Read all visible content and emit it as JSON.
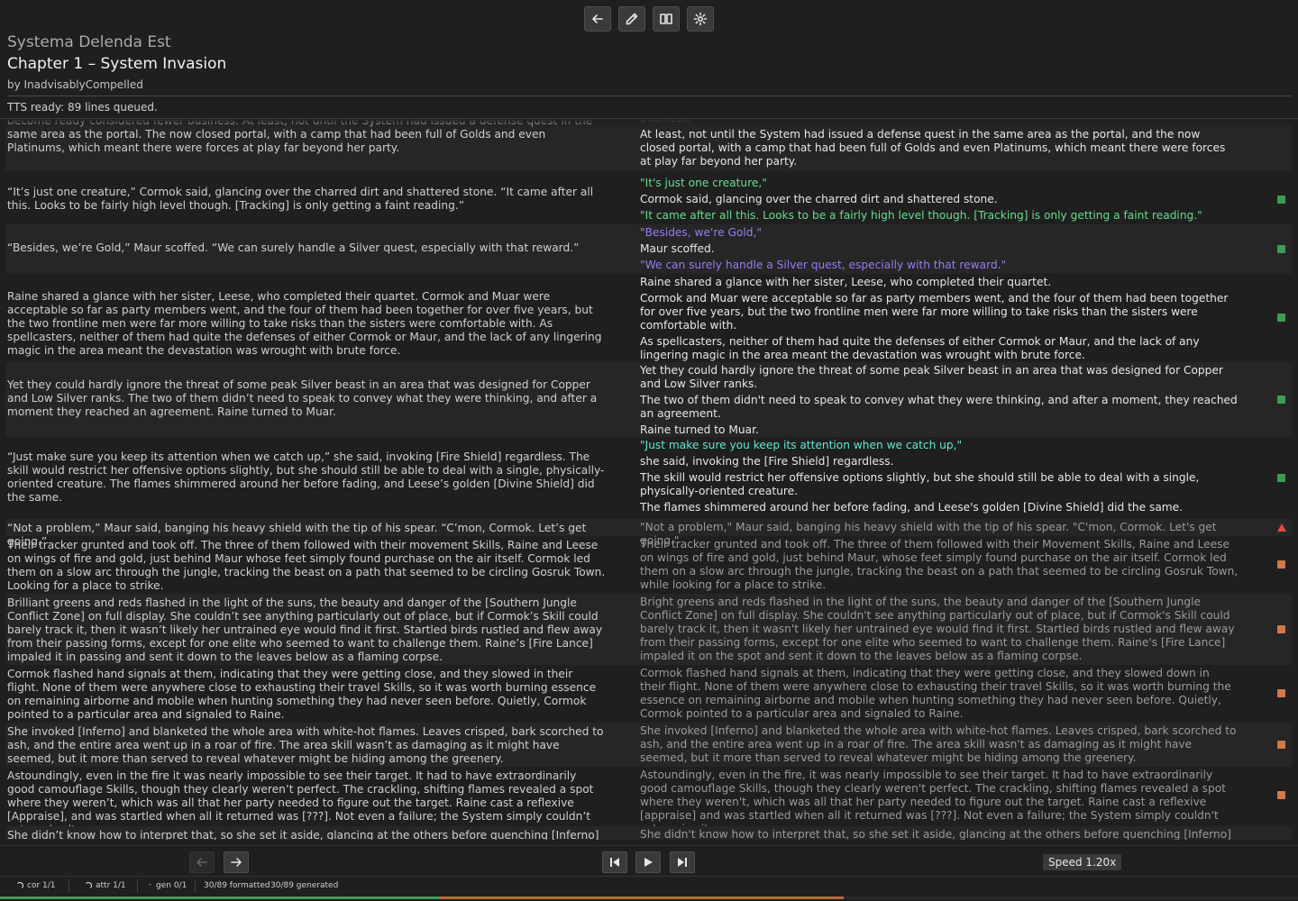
{
  "book": {
    "title": "Systema Delenda Est",
    "chapter": "Chapter 1 – System Invasion",
    "author": "by InadvisablyCompelled"
  },
  "tts_status": "TTS ready: 89 lines queued.",
  "toolbar": {
    "icons": [
      "back-arrow-icon",
      "pencil-icon",
      "book-icon",
      "gear-icon"
    ]
  },
  "rows": [
    {
      "left": "become ready considered fewer business. At least, not until the System had issued a defense quest in the same area as the portal. The now closed portal, with a camp that had been full of Golds and even Platinums, which meant there were forces at play far beyond her party.",
      "right": [
        {
          "text": "business.",
          "style": "dim"
        },
        {
          "text": "At least, not until the System had issued a defense quest in the same area as the portal, and the now closed portal, with a camp that had been full of Golds and even Platinums, which meant there were forces at play far beyond her party.",
          "style": "normal"
        }
      ],
      "status": ""
    },
    {
      "left": "“It’s just one creature,” Cormok said, glancing over the charred dirt and shattered stone. “It came after all this. Looks to be fairly high level though. [Tracking] is only getting a faint reading.”",
      "right": [
        {
          "text": "\"It's just one creature,\"",
          "style": "q1"
        },
        {
          "text": "Cormok said, glancing over the charred dirt and shattered stone.",
          "style": "normal"
        },
        {
          "text": "\"It came after all this. Looks to be a fairly high level though. [Tracking] is only getting a faint reading.\"",
          "style": "q1"
        }
      ],
      "status": "ok"
    },
    {
      "left": "“Besides, we’re Gold,” Maur scoffed. “We can surely handle a Silver quest, especially with that reward.”",
      "right": [
        {
          "text": "\"Besides, we're Gold,\"",
          "style": "q2"
        },
        {
          "text": "Maur scoffed.",
          "style": "normal"
        },
        {
          "text": "\"We can surely handle a Silver quest, especially with that reward.\"",
          "style": "q2"
        }
      ],
      "status": "ok"
    },
    {
      "left": "Raine shared a glance with her sister, Leese, who completed their quartet. Cormok and Muar were acceptable so far as party members went, and the four of them had been together for over five years, but the two frontline men were far more willing to take risks than the sisters were comfortable with. As spellcasters, neither of them had quite the defenses of either Cormok or Maur, and the lack of any lingering magic in the area meant the devastation was wrought with brute force.",
      "right": [
        {
          "text": "Raine shared a glance with her sister, Leese, who completed their quartet.",
          "style": "normal"
        },
        {
          "text": "Cormok and Muar were acceptable so far as party members went, and the four of them had been together for over five years, but the two frontline men were far more willing to take risks than the sisters were comfortable with.",
          "style": "normal"
        },
        {
          "text": "As spellcasters, neither of them had quite the defenses of either Cormok or Maur, and the lack of any lingering magic in the area meant the devastation was wrought with brute force.",
          "style": "normal"
        }
      ],
      "status": "ok"
    },
    {
      "left": "Yet they could hardly ignore the threat of some peak Silver beast in an area that was designed for Copper and Low Silver ranks. The two of them didn’t need to speak to convey what they were thinking, and after a moment they reached an agreement. Raine turned to Muar.",
      "right": [
        {
          "text": "Yet they could hardly ignore the threat of some peak Silver beast in an area that was designed for Copper and Low Silver ranks.",
          "style": "normal"
        },
        {
          "text": "The two of them didn't need to speak to convey what they were thinking, and after a moment, they reached an agreement.",
          "style": "normal"
        },
        {
          "text": "Raine turned to Muar.",
          "style": "normal"
        }
      ],
      "status": "ok"
    },
    {
      "left": "“Just make sure you keep its attention when we catch up,” she said, invoking [Fire Shield] regardless. The skill would restrict her offensive options slightly, but she should still be able to deal with a single, physically-oriented creature. The flames shimmered around her before fading, and Leese’s golden [Divine Shield] did the same.",
      "right": [
        {
          "text": "\"Just make sure you keep its attention when we catch up,\"",
          "style": "q3"
        },
        {
          "text": "she said, invoking the [Fire Shield] regardless.",
          "style": "normal"
        },
        {
          "text": "The skill would restrict her offensive options slightly, but she should still be able to deal with a single, physically-oriented creature.",
          "style": "normal"
        },
        {
          "text": "The flames shimmered around her before fading, and Leese's golden [Divine Shield] did the same.",
          "style": "normal"
        }
      ],
      "status": "ok"
    },
    {
      "left": "“Not a problem,” Maur said, banging his heavy shield with the tip of his spear. “C’mon, Cormok. Let’s get going.”",
      "right": [
        {
          "text": "\"Not a problem,\" Maur said, banging his heavy shield with the tip of his spear. \"C'mon, Cormok. Let's get going.\"",
          "style": "dim"
        }
      ],
      "status": "err"
    },
    {
      "left": "Their tracker grunted and took off. The three of them followed with their movement Skills, Raine and Leese on wings of fire and gold, just behind Maur whose feet simply found purchase on the air itself. Cormok led them on a slow arc through the jungle, tracking the beast on a path that seemed to be circling Gosruk Town. Looking for a place to strike.",
      "right": [
        {
          "text": "Their tracker grunted and took off. The three of them followed with their Movement Skills, Raine and Leese on wings of fire and gold, just behind Maur, whose feet simply found purchase on the air itself. Cormok led them on a slow arc through the jungle, tracking the beast on a path that seemed to be circling Gosruk Town, while looking for a place to strike.",
          "style": "dim"
        }
      ],
      "status": "warn"
    },
    {
      "left": "Brilliant greens and reds flashed in the light of the suns, the beauty and danger of the [Southern Jungle Conflict Zone] on full display. She couldn’t see anything particularly out of place, but if Cormok’s Skill could barely track it, then it wasn’t likely her untrained eye would find it first. Startled birds rustled and flew away from their passing forms, except for one elite who seemed to want to challenge them. Raine’s [Fire Lance] impaled it in passing and sent it down to the leaves below as a flaming corpse.",
      "right": [
        {
          "text": "Bright greens and reds flashed in the light of the suns, the beauty and danger of the [Southern Jungle Conflict Zone] on full display. She couldn't see anything particularly out of place, but if Cormok's Skill could barely track it, then it wasn't likely her untrained eye would find it first. Startled birds rustled and flew away from their passing forms, except for one elite who seemed to want to challenge them. Raine's [Fire Lance] impaled it on the spot and sent it down to the leaves below as a flaming corpse.",
          "style": "dim"
        }
      ],
      "status": "warn"
    },
    {
      "left": "Cormok flashed hand signals at them, indicating that they were getting close, and they slowed in their flight. None of them were anywhere close to exhausting their travel Skills, so it was worth burning essence on remaining airborne and mobile when hunting something they had never seen before. Quietly, Cormok pointed to a particular area and signaled to Raine.",
      "right": [
        {
          "text": "Cormok flashed hand signals at them, indicating that they were getting close, and they slowed down in their flight. None of them were anywhere close to exhausting their travel Skills, so it was worth burning the essence on remaining airborne and mobile when hunting something they had never seen before. Quietly, Cormok pointed to a particular area and signaled to Raine.",
          "style": "dim"
        }
      ],
      "status": "warn"
    },
    {
      "left": "She invoked [Inferno] and blanketed the whole area with white-hot flames. Leaves crisped, bark scorched to ash, and the entire area went up in a roar of fire. The area skill wasn’t as damaging as it might have seemed, but it more than served to reveal whatever might be hiding among the greenery.",
      "right": [
        {
          "text": "She invoked [Inferno] and blanketed the whole area with white-hot flames. Leaves crisped, bark scorched to ash, and the entire area went up in a roar of fire. The area skill wasn't as damaging as it might have seemed, but it more than served to reveal whatever might be hiding among the greenery.",
          "style": "dim"
        }
      ],
      "status": "warn"
    },
    {
      "left": "Astoundingly, even in the fire it was nearly impossible to see their target. It had to have extraordinarily good camouflage Skills, though they clearly weren’t perfect. The crackling, shifting flames revealed a spot where they weren’t, which was all that her party needed to figure out the target. Raine cast a reflexive [Appraise], and was startled when all it returned was [???]. Not even a failure; the System simply couldn’t categorize it.",
      "right": [
        {
          "text": "Astoundingly, even in the fire, it was nearly impossible to see their target. It had to have extraordinarily good camouflage Skills, though they clearly weren't perfect. The crackling, shifting flames revealed a spot where they weren't, which was all that her party needed to figure out the target. Raine cast a reflexive [appraise] and was startled when all it returned was [???]. Not even a failure; the System simply couldn't categorize it.",
          "style": "dim"
        }
      ],
      "status": "warn"
    },
    {
      "left": "She didn’t know how to interpret that, so she set it aside, glancing at the others before quenching [Inferno] and letting her party members advance on the target.",
      "right": [
        {
          "text": "She didn't know how to interpret that, so she set it aside, glancing at the others before quenching [Inferno] and letting her party members advance on the target.",
          "style": "dim"
        }
      ],
      "status": ""
    }
  ],
  "player": {
    "speed_label": "Speed 1.20x"
  },
  "statusbar": {
    "cor": "cor 1/1",
    "attr": "attr 1/1",
    "gen": "gen 0/1",
    "formatted": "30/89 formatted",
    "generated": "30/89 generated",
    "formatted_fraction": 0.339,
    "generated_fraction": 0.65
  },
  "colors": {
    "quote_green": "#66dd88",
    "quote_purple": "#9b7af2",
    "quote_cyan": "#5fe6d0",
    "ok": "#3f9a52",
    "warn": "#d0784a",
    "error": "#e04848"
  }
}
